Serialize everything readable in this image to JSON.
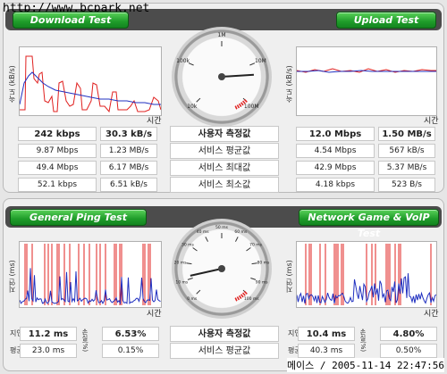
{
  "watermark": "http://www.bcpark.net",
  "footer_stamp": "메이스 / 2005-11-14 22:47:56",
  "download": {
    "title": "Download Test",
    "y_label": "속도 (kB/s)",
    "x_label": "시간",
    "stats": [
      [
        "242 kbps",
        "30.3 kB/s"
      ],
      [
        "9.87 Mbps",
        "1.23 MB/s"
      ],
      [
        "49.4 Mbps",
        "6.17 MB/s"
      ],
      [
        "52.1 kbps",
        "6.51 kB/s"
      ]
    ]
  },
  "upload": {
    "title": "Upload Test",
    "y_label": "속도 (kB/s)",
    "x_label": "시간",
    "stats": [
      [
        "12.0 Mbps",
        "1.50 MB/s"
      ],
      [
        "4.54 Mbps",
        "567 kB/s"
      ],
      [
        "42.9 Mbps",
        "5.37 MB/s"
      ],
      [
        "4.18 kbps",
        "523 B/s"
      ]
    ]
  },
  "center_labels_top": [
    "사용자 측정값",
    "서비스 평균값",
    "서비스 최대값",
    "서비스 최소값"
  ],
  "speed_gauge": {
    "ticks": [
      "10k",
      "100k",
      "1M",
      "10M",
      "100M"
    ],
    "needle_fraction": 0.82
  },
  "ping": {
    "title": "General Ping Test",
    "y_label": "지연 (ms)",
    "x_label": "시간",
    "row_labels": [
      "지연",
      "평균"
    ],
    "loss_label": "손실(%)",
    "stats": [
      [
        "11.2 ms",
        "6.53%"
      ],
      [
        "23.0 ms",
        "0.15%"
      ]
    ]
  },
  "game": {
    "title": "Network Game & VoIP Test",
    "y_label": "지연 (ms)",
    "x_label": "시간",
    "row_labels": [
      "지연",
      "평균"
    ],
    "loss_label": "손실(%)",
    "stats": [
      [
        "10.4 ms",
        "4.80%"
      ],
      [
        "40.3 ms",
        "0.50%"
      ]
    ]
  },
  "center_labels_bottom": [
    "사용자 측정값",
    "서비스 평균값"
  ],
  "ping_gauge": {
    "ticks": [
      "0 ms",
      "10 ms",
      "20 ms",
      "30 ms",
      "40 ms",
      "50 ms",
      "60 ms",
      "70 ms",
      "80 ms",
      "90 ms",
      "100 ms"
    ],
    "needle_fraction": 0.12
  },
  "colors": {
    "green_button": "#1f9c2a",
    "series_red": "#e0201f",
    "series_blue": "#2030c0"
  }
}
